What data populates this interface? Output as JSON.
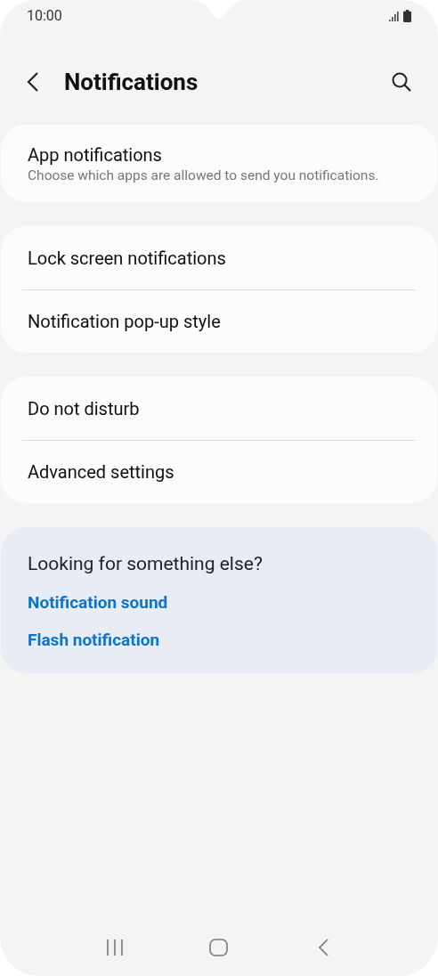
{
  "status_bar": {
    "time": "10:00"
  },
  "header": {
    "title": "Notifications"
  },
  "sections": [
    {
      "items": [
        {
          "title": "App notifications",
          "subtitle": "Choose which apps are allowed to send you notifications."
        }
      ]
    },
    {
      "items": [
        {
          "title": "Lock screen notifications"
        },
        {
          "title": "Notification pop-up style"
        }
      ]
    },
    {
      "items": [
        {
          "title": "Do not disturb"
        },
        {
          "title": "Advanced settings"
        }
      ]
    }
  ],
  "suggestions": {
    "title": "Looking for something else?",
    "links": [
      "Notification sound",
      "Flash notification"
    ]
  }
}
